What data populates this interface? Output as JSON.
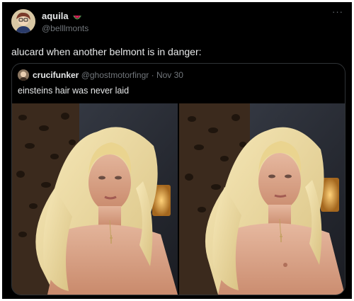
{
  "author": {
    "display_name": "aquila",
    "handle": "@belllmonts",
    "badge_icon": "watermelon-icon"
  },
  "tweet": {
    "text": "alucard when another belmont is in danger:"
  },
  "quoted_tweet": {
    "display_name": "crucifunker",
    "handle": "@ghostmotorfingr",
    "separator": " · ",
    "date": "Nov 30",
    "text": "einsteins hair was never laid",
    "photo_count": 2
  },
  "colors": {
    "background": "#000000",
    "primary_text": "#e7e9ea",
    "secondary_text": "#71767b",
    "border": "#2f3336",
    "watermelon_red": "#e0245e",
    "watermelon_green": "#3a9a4a"
  }
}
